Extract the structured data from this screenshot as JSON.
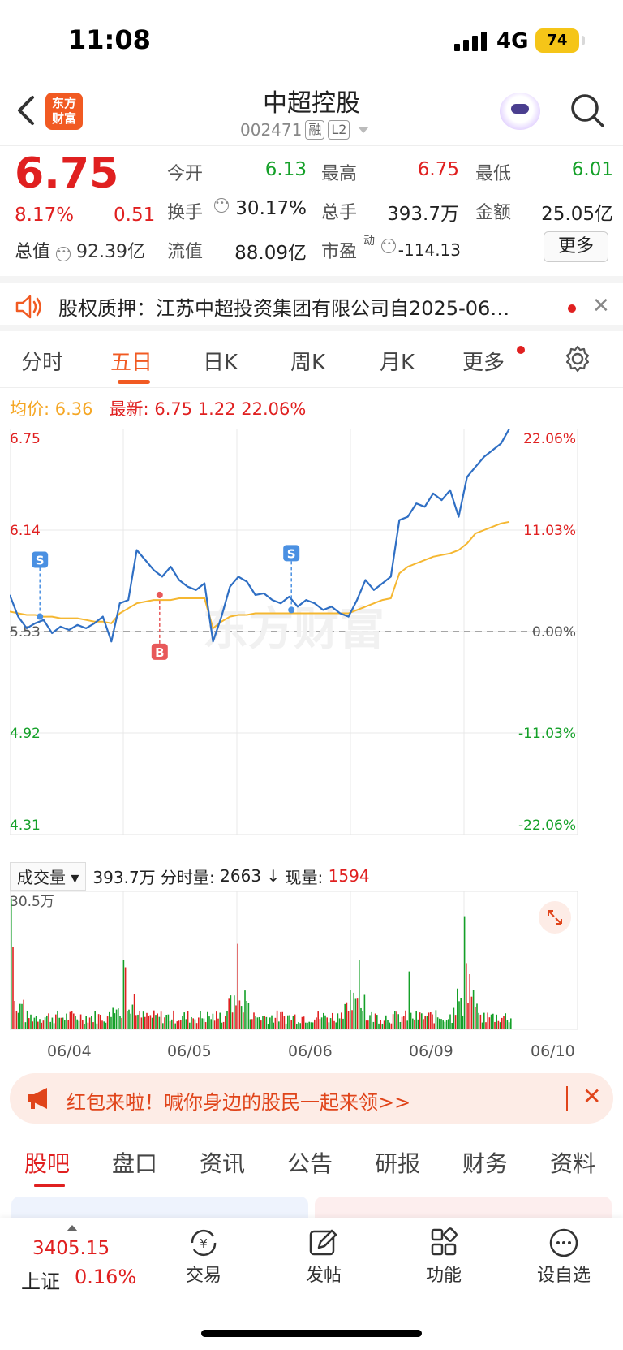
{
  "status": {
    "time": "11:08",
    "network": "4G",
    "battery": "74"
  },
  "header": {
    "logo_line1": "东方",
    "logo_line2": "财富",
    "title": "中超控股",
    "code": "002471",
    "tag1": "融",
    "tag2": "L2"
  },
  "quote": {
    "price": "6.75",
    "pct": "8.17%",
    "change": "0.51",
    "total_value_label": "总值",
    "total_value": "92.39亿",
    "open_label": "今开",
    "open": "6.13",
    "high_label": "最高",
    "high": "6.75",
    "low_label": "最低",
    "low": "6.01",
    "turnover_label": "换手",
    "turnover": "30.17%",
    "volume_label": "总手",
    "volume": "393.7万",
    "amount_label": "金额",
    "amount": "25.05亿",
    "float_label": "流值",
    "float_value": "88.09亿",
    "pe_label": "市盈",
    "pe_sup": "动",
    "pe": "-114.13",
    "more": "更多"
  },
  "notice": {
    "text": "股权质押：江苏中超投资集团有限公司自2025-06…",
    "close": "✕"
  },
  "tabs": [
    "分时",
    "五日",
    "日K",
    "周K",
    "月K",
    "更多"
  ],
  "active_tab": "五日",
  "info": {
    "avg_label": "均价:",
    "avg": "6.36",
    "latest_label": "最新:",
    "latest": "6.75",
    "chg": "1.22",
    "pct": "22.06%"
  },
  "chart_data": {
    "type": "line",
    "y_left": [
      "6.75",
      "6.14",
      "5.53",
      "4.92",
      "4.31"
    ],
    "y_right": [
      "22.06%",
      "11.03%",
      "0.00%",
      "-11.03%",
      "-22.06%"
    ],
    "ylim": [
      4.31,
      6.75
    ],
    "base": 5.53,
    "days": [
      "06/04",
      "06/05",
      "06/06",
      "06/09",
      "06/10"
    ],
    "watermark": "东方财富",
    "series": [
      {
        "values": [
          5.75,
          5.62,
          5.55,
          5.58,
          5.6,
          5.52,
          5.56,
          5.54,
          5.57,
          5.55,
          5.58,
          5.62,
          5.47,
          5.7,
          5.72,
          6.02,
          5.96,
          5.9,
          5.86,
          5.92,
          5.84,
          5.8,
          5.78,
          5.82,
          5.47,
          5.62,
          5.8,
          5.86,
          5.83,
          5.75,
          5.76,
          5.72,
          5.7,
          5.74,
          5.68,
          5.72,
          5.7,
          5.66,
          5.68,
          5.64,
          5.62,
          5.72,
          5.84,
          5.78,
          5.82,
          5.86,
          6.2,
          6.22,
          6.3,
          6.28,
          6.36,
          6.32,
          6.38,
          6.22,
          6.46,
          6.52,
          6.58,
          6.62,
          6.66,
          6.75
        ]
      },
      {
        "values": [
          5.65,
          5.64,
          5.63,
          5.63,
          5.62,
          5.62,
          5.61,
          5.61,
          5.61,
          5.6,
          5.59,
          5.59,
          5.58,
          5.64,
          5.67,
          5.7,
          5.71,
          5.72,
          5.72,
          5.72,
          5.73,
          5.73,
          5.73,
          5.73,
          5.55,
          5.59,
          5.62,
          5.63,
          5.63,
          5.64,
          5.64,
          5.64,
          5.64,
          5.64,
          5.64,
          5.64,
          5.64,
          5.64,
          5.64,
          5.64,
          5.64,
          5.66,
          5.68,
          5.7,
          5.72,
          5.73,
          5.88,
          5.92,
          5.94,
          5.96,
          5.98,
          5.99,
          6.0,
          6.02,
          6.06,
          6.12,
          6.14,
          6.16,
          6.18,
          6.19
        ]
      }
    ],
    "markers": [
      {
        "label": "S"
      },
      {
        "label": "B"
      },
      {
        "label": "S"
      }
    ]
  },
  "volume": {
    "selector": "成交量",
    "total": "393.7万",
    "fen_label": "分时量:",
    "fen_value": "2663",
    "now_label": "现量:",
    "now_value": "1594",
    "max": "30.5万"
  },
  "banner": {
    "text": "红包来啦！喊你身边的股民一起来领>>",
    "close": "✕"
  },
  "bottom_tabs": [
    "股吧",
    "盘口",
    "资讯",
    "公告",
    "研报",
    "财务",
    "资料"
  ],
  "index": {
    "value": "3405.15",
    "name": "上证",
    "pct": "0.16%"
  },
  "nav": [
    "交易",
    "发帖",
    "功能",
    "设自选"
  ]
}
